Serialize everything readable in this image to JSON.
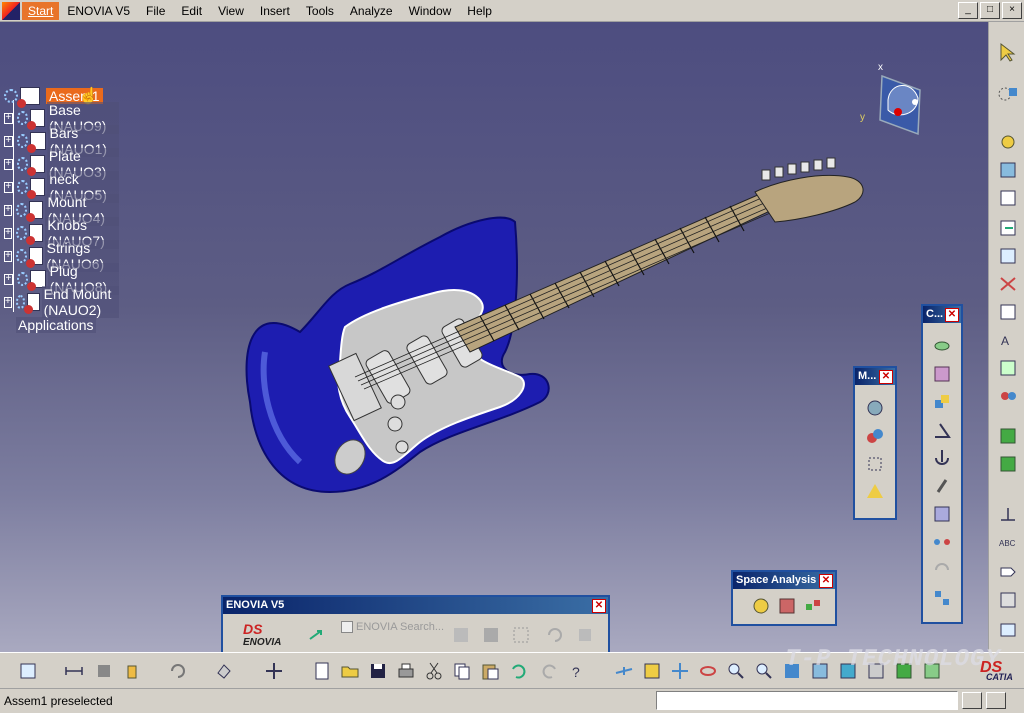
{
  "menubar": {
    "start": "Start",
    "items": [
      "ENOVIA V5",
      "File",
      "Edit",
      "View",
      "Insert",
      "Tools",
      "Analyze",
      "Window",
      "Help"
    ],
    "window_buttons": [
      "_",
      "□",
      "×"
    ]
  },
  "tree": {
    "root": "Assem1",
    "children": [
      "Base (NAUO9)",
      "Bars (NAUO1)",
      "Plate (NAUO3)",
      "neck (NAUO5)",
      "Mount (NAUO4)",
      "Knobs (NAUO7)",
      "Strings (NAUO6)",
      "Plug (NAUO8)",
      "End Mount (NAUO2)"
    ],
    "applications": "Applications"
  },
  "compass": {
    "x_label": "x",
    "y_label": "y"
  },
  "panels": {
    "m_title": "M...",
    "c_title": "C...",
    "space_analysis_title": "Space Analysis",
    "enovia_title": "ENOVIA V5",
    "enovia_search": "ENOVIA Search...",
    "enovia_logo": "ENOVIA"
  },
  "status": {
    "text": "Assem1 preselected"
  },
  "watermark": "T-P TECHNOLOGY",
  "catia_logo": "CATIA",
  "colors": {
    "guitar_body": "#1c1ca8",
    "pickguard": "#c9c9c9",
    "neck": "#b7a37c",
    "tree_highlight": "#ea6a1c",
    "title_bar": "#0a246a"
  }
}
